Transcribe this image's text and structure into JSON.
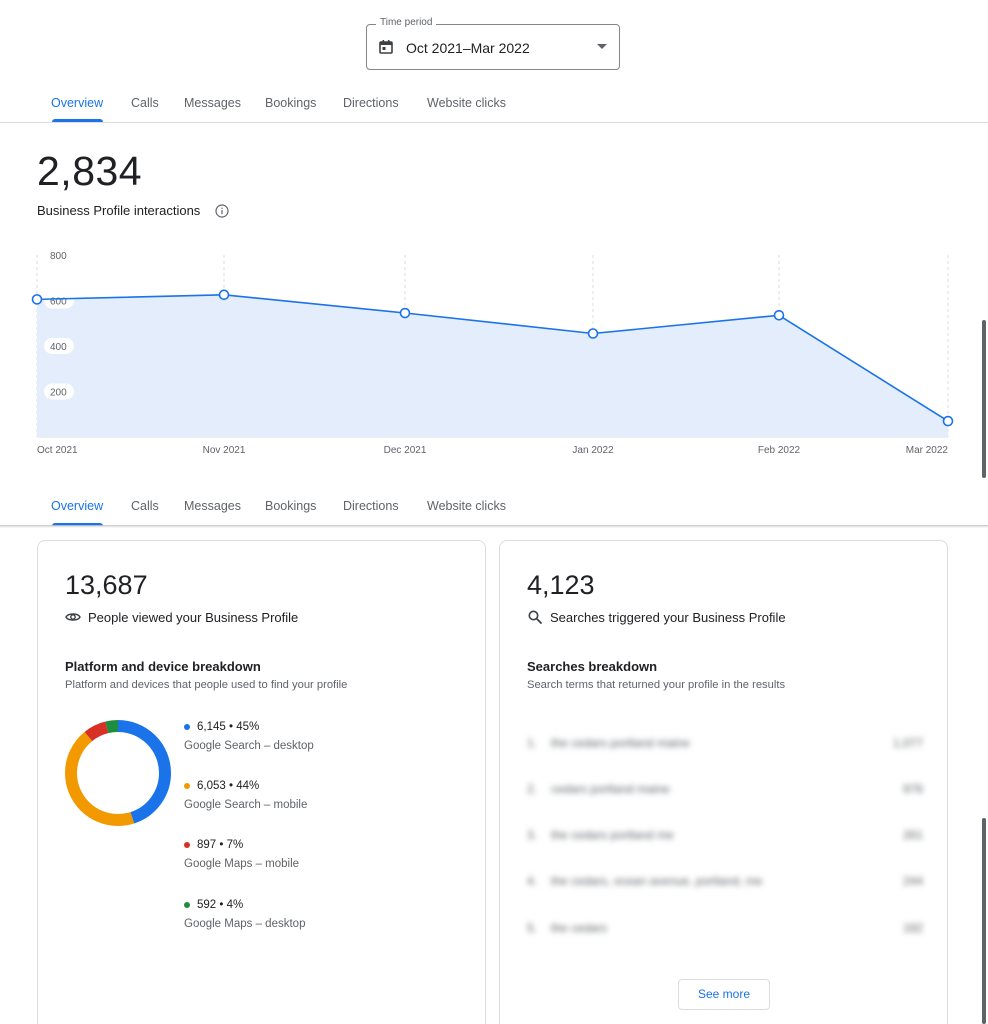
{
  "period": {
    "legend": "Time period",
    "value": "Oct 2021–Mar 2022"
  },
  "tabs": [
    {
      "label": "Overview",
      "active": true
    },
    {
      "label": "Calls"
    },
    {
      "label": "Messages"
    },
    {
      "label": "Bookings"
    },
    {
      "label": "Directions"
    },
    {
      "label": "Website clicks"
    }
  ],
  "summary": {
    "total": "2,834",
    "label": "Business Profile interactions"
  },
  "chart_data": {
    "type": "area",
    "categories": [
      "Oct 2021",
      "Nov 2021",
      "Dec 2021",
      "Jan 2022",
      "Feb 2022",
      "Mar 2022"
    ],
    "values": [
      605,
      625,
      545,
      455,
      535,
      70
    ],
    "y_ticks": [
      "800",
      "600",
      "400",
      "200"
    ],
    "ylim": [
      0,
      800
    ],
    "line_color": "#1a73e8",
    "fill_color": "#e3edfc",
    "grid": "vertical dashed"
  },
  "views_card": {
    "total": "13,687",
    "label": "People viewed your Business Profile",
    "heading": "Platform and device breakdown",
    "description": "Platform and devices that people used to find your profile",
    "breakdown": [
      {
        "value": "6,145 • 45%",
        "name": "Google Search – desktop",
        "color": "#1a73e8",
        "share": 45
      },
      {
        "value": "6,053 • 44%",
        "name": "Google Search – mobile",
        "color": "#f29900",
        "share": 44
      },
      {
        "value": "897 • 7%",
        "name": "Google Maps – mobile",
        "color": "#d93025",
        "share": 7
      },
      {
        "value": "592 • 4%",
        "name": "Google Maps – desktop",
        "color": "#1e8e3e",
        "share": 4
      }
    ]
  },
  "searches_card": {
    "total": "4,123",
    "label": "Searches triggered your Business Profile",
    "heading": "Searches breakdown",
    "description": "Search terms that returned your profile in the results",
    "rows": [
      {
        "rank": "1.",
        "term": "the cedars portland maine",
        "count": "1,077"
      },
      {
        "rank": "2.",
        "term": "cedars portland maine",
        "count": "976"
      },
      {
        "rank": "3.",
        "term": "the cedars portland me",
        "count": "261"
      },
      {
        "rank": "4.",
        "term": "the cedars, ocean avenue, portland, me",
        "count": "244"
      },
      {
        "rank": "5.",
        "term": "the cedars",
        "count": "182"
      }
    ],
    "see_more": "See more"
  }
}
